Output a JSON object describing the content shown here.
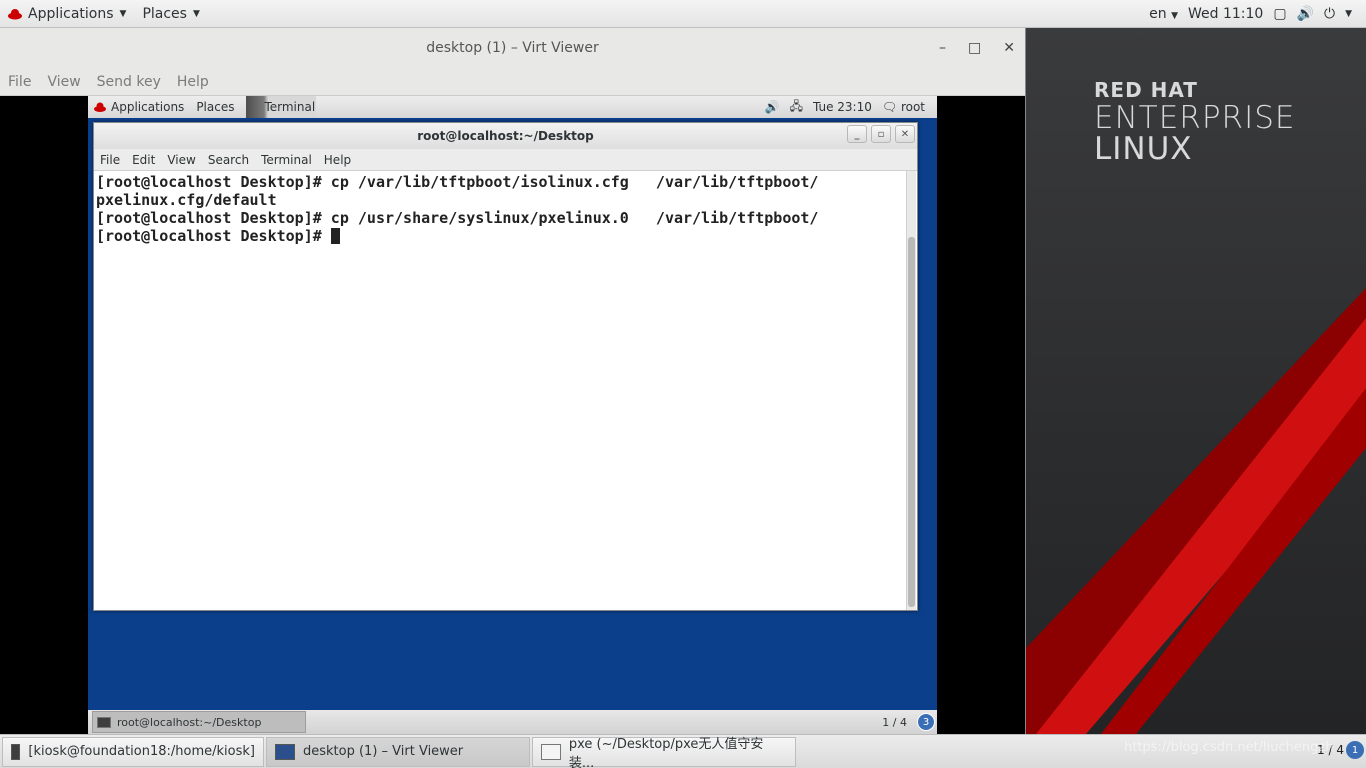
{
  "host_topbar": {
    "applications": "Applications",
    "places": "Places",
    "language": "en",
    "clock": "Wed 11:10"
  },
  "virt_viewer": {
    "title": "desktop (1) – Virt Viewer",
    "menu": [
      "File",
      "View",
      "Send key",
      "Help"
    ]
  },
  "guest_topbar": {
    "applications": "Applications",
    "places": "Places",
    "terminal_tab": "Terminal",
    "clock": "Tue 23:10",
    "user": "root"
  },
  "terminal": {
    "title": "root@localhost:~/Desktop",
    "menu": [
      "File",
      "Edit",
      "View",
      "Search",
      "Terminal",
      "Help"
    ],
    "lines": [
      "[root@localhost Desktop]# cp /var/lib/tftpboot/isolinux.cfg   /var/lib/tftpboot/",
      "pxelinux.cfg/default",
      "[root@localhost Desktop]# cp /usr/share/syslinux/pxelinux.0   /var/lib/tftpboot/",
      "[root@localhost Desktop]# "
    ]
  },
  "guest_bottombar": {
    "task": "root@localhost:~/Desktop",
    "pager": "1 / 4",
    "badge": "3"
  },
  "host_bottombar": {
    "tasks": [
      "[kiosk@foundation18:/home/kiosk]",
      "desktop (1) – Virt Viewer",
      "pxe (~/Desktop/pxe无人值守安装..."
    ],
    "pager": "1 / 4",
    "badge": "1"
  },
  "wallpaper": {
    "line1": "RED HAT",
    "line2": "ENTERPRISE",
    "line3": "LINUX"
  },
  "watermark": "https://blog.csdn.net/liuchengzh",
  "colors": {
    "guest_bg": "#0b3f8c",
    "red_accent": "#cc0000"
  }
}
